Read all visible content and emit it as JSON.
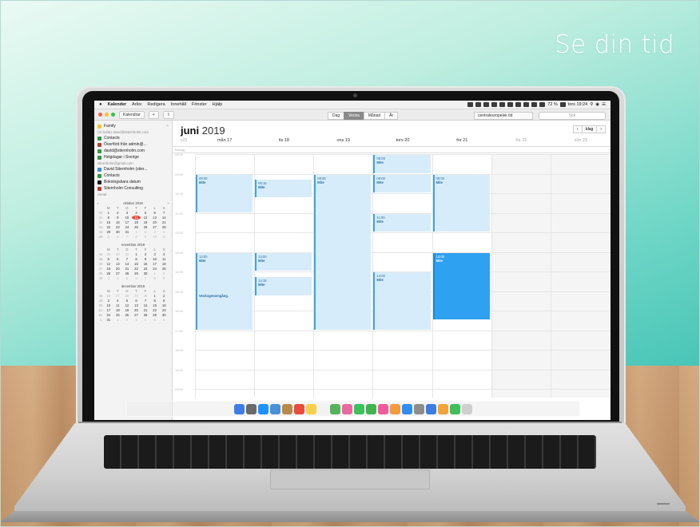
{
  "headline": "Se din tid",
  "menubar": {
    "apple": "",
    "app_name": "Kalender",
    "menus": [
      "Arkiv",
      "Redigera",
      "Innehåll",
      "Fönster",
      "Hjälp"
    ],
    "battery": "72 %",
    "clock": "tors 19:24"
  },
  "toolbar": {
    "calendars_button": "Kalendrar",
    "add_button": "+",
    "views": [
      "Dag",
      "Vecka",
      "Månad",
      "År"
    ],
    "active_view": "Vecka",
    "timezone": "centraleuropeisk tid",
    "search_placeholder": "Sök",
    "today_button": "Idag",
    "prev": "‹",
    "next": "›"
  },
  "sidebar": {
    "family": "Family",
    "group1_account": "(Vi bufär) david@stiernholm.com",
    "group1_items": [
      {
        "label": "Contacts",
        "color": "#2d9a3c"
      },
      {
        "label": "Överförd från admin@...",
        "color": "#c0392b"
      },
      {
        "label": "david@stiernholm.com",
        "color": "#2d9a3c"
      },
      {
        "label": "Helgdagar i Sverige",
        "color": "#2d9a3c"
      }
    ],
    "group2_account": "stiernholm@gmail.com",
    "group2_items": [
      {
        "label": "David Stiernholm (stier...",
        "color": "#3b8ee0"
      },
      {
        "label": "Contacts",
        "color": "#2d9a3c"
      },
      {
        "label": "Bokningsbara datum",
        "color": "#111111"
      },
      {
        "label": "Stiernholm Consulting",
        "color": "#c0392b"
      }
    ],
    "group3_account": "Annat"
  },
  "mini_calendars": [
    {
      "title": "oktober 2018",
      "weekday_heads": [
        "M",
        "T",
        "O",
        "T",
        "F",
        "L",
        "S"
      ],
      "rows": [
        {
          "wk": "40",
          "days": [
            "1",
            "2",
            "3",
            "4",
            "5",
            "6",
            "7"
          ]
        },
        {
          "wk": "41",
          "days": [
            "8",
            "9",
            "10",
            "11",
            "12",
            "13",
            "14"
          ]
        },
        {
          "wk": "42",
          "days": [
            "15",
            "16",
            "17",
            "18",
            "19",
            "20",
            "21"
          ]
        },
        {
          "wk": "43",
          "days": [
            "22",
            "23",
            "24",
            "25",
            "26",
            "27",
            "28"
          ]
        },
        {
          "wk": "44",
          "days": [
            "29",
            "30",
            "31",
            "1",
            "2",
            "3",
            "4"
          ]
        },
        {
          "wk": "45",
          "days": [
            "5",
            "6",
            "7",
            "8",
            "9",
            "10",
            "11"
          ]
        }
      ],
      "today": "11"
    },
    {
      "title": "november 2018",
      "weekday_heads": [
        "M",
        "T",
        "O",
        "T",
        "F",
        "L",
        "S"
      ],
      "rows": [
        {
          "wk": "44",
          "days": [
            "29",
            "30",
            "31",
            "1",
            "2",
            "3",
            "4"
          ]
        },
        {
          "wk": "45",
          "days": [
            "5",
            "6",
            "7",
            "8",
            "9",
            "10",
            "11"
          ]
        },
        {
          "wk": "46",
          "days": [
            "12",
            "13",
            "14",
            "15",
            "16",
            "17",
            "18"
          ]
        },
        {
          "wk": "47",
          "days": [
            "19",
            "20",
            "21",
            "22",
            "23",
            "24",
            "25"
          ]
        },
        {
          "wk": "48",
          "days": [
            "26",
            "27",
            "28",
            "29",
            "30",
            "1",
            "2"
          ]
        },
        {
          "wk": "49",
          "days": [
            "3",
            "4",
            "5",
            "6",
            "7",
            "8",
            "9"
          ]
        }
      ],
      "today": ""
    },
    {
      "title": "december 2018",
      "weekday_heads": [
        "M",
        "T",
        "O",
        "T",
        "F",
        "L",
        "S"
      ],
      "rows": [
        {
          "wk": "48",
          "days": [
            "26",
            "27",
            "28",
            "29",
            "30",
            "1",
            "2"
          ]
        },
        {
          "wk": "49",
          "days": [
            "3",
            "4",
            "5",
            "6",
            "7",
            "8",
            "9"
          ]
        },
        {
          "wk": "50",
          "days": [
            "10",
            "11",
            "12",
            "13",
            "14",
            "15",
            "16"
          ]
        },
        {
          "wk": "51",
          "days": [
            "17",
            "18",
            "19",
            "20",
            "21",
            "22",
            "23"
          ]
        },
        {
          "wk": "52",
          "days": [
            "24",
            "25",
            "26",
            "27",
            "28",
            "29",
            "30"
          ]
        },
        {
          "wk": "1",
          "days": [
            "31",
            "1",
            "2",
            "3",
            "4",
            "5",
            "6"
          ]
        }
      ],
      "today": ""
    }
  ],
  "calendar": {
    "month": "juni",
    "year": "2019",
    "week": "v25",
    "allday_label": "heldag",
    "days": [
      {
        "label": "mån 17",
        "weekend": false
      },
      {
        "label": "tis 18",
        "weekend": false
      },
      {
        "label": "ons 19",
        "weekend": false
      },
      {
        "label": "tors 20",
        "weekend": false
      },
      {
        "label": "fre 21",
        "weekend": false
      },
      {
        "label": "lör 22",
        "weekend": true
      },
      {
        "label": "sön 23",
        "weekend": true
      }
    ],
    "time_labels": [
      "08:00",
      "09:00",
      "10:00",
      "11:00",
      "12:00",
      "13:00",
      "14:00",
      "15:00",
      "16:00",
      "17:00",
      "18:00",
      "19:00",
      "20:00"
    ],
    "events": [
      {
        "day": 3,
        "start": 8.0,
        "end": 9.0,
        "time": "08:00",
        "title": "Mite",
        "selected": false
      },
      {
        "day": 0,
        "start": 9.0,
        "end": 11.0,
        "time": "09:00",
        "title": "Mite",
        "selected": false
      },
      {
        "day": 1,
        "start": 9.25,
        "end": 10.25,
        "time": "09:15",
        "title": "Mite",
        "selected": false
      },
      {
        "day": 2,
        "start": 9.0,
        "end": 17.0,
        "time": "09:00",
        "title": "Mite",
        "selected": false
      },
      {
        "day": 3,
        "start": 9.0,
        "end": 10.0,
        "time": "09:00",
        "title": "Mite",
        "selected": false
      },
      {
        "day": 4,
        "start": 9.0,
        "end": 12.0,
        "time": "09:00",
        "title": "Mite",
        "selected": false
      },
      {
        "day": 3,
        "start": 11.0,
        "end": 12.0,
        "time": "11:00",
        "title": "Mite",
        "selected": false
      },
      {
        "day": 0,
        "start": 13.0,
        "end": 17.0,
        "time": "13:00",
        "title": "Mite",
        "selected": false
      },
      {
        "day": 1,
        "start": 13.0,
        "end": 14.0,
        "time": "13:00",
        "title": "Mite",
        "selected": false
      },
      {
        "day": 1,
        "start": 14.25,
        "end": 15.25,
        "time": "14:15",
        "title": "Mite",
        "selected": false
      },
      {
        "day": 3,
        "start": 14.0,
        "end": 17.0,
        "time": "14:00",
        "title": "Mite",
        "selected": false
      },
      {
        "day": 4,
        "start": 13.0,
        "end": 16.5,
        "time": "13:00",
        "title": "Mite",
        "selected": true
      },
      {
        "day": 0,
        "start": 15.0,
        "end": 16.0,
        "time": "",
        "title": "Veckogenomgång.",
        "selected": false
      }
    ]
  },
  "colors": {
    "accent": "#2ea1f0",
    "today_red": "#e8463b"
  },
  "dock_icons": [
    "finder-icon",
    "launchpad-icon",
    "safari-icon",
    "mail-icon",
    "contacts-icon",
    "calendar-icon",
    "notes-icon",
    "reminders-icon",
    "maps-icon",
    "photos-icon",
    "messages-icon",
    "facetime-icon",
    "itunes-icon",
    "books-icon",
    "app-store-icon",
    "system-preferences-icon",
    "keynote-icon",
    "pages-icon",
    "numbers-icon",
    "trash-icon"
  ]
}
